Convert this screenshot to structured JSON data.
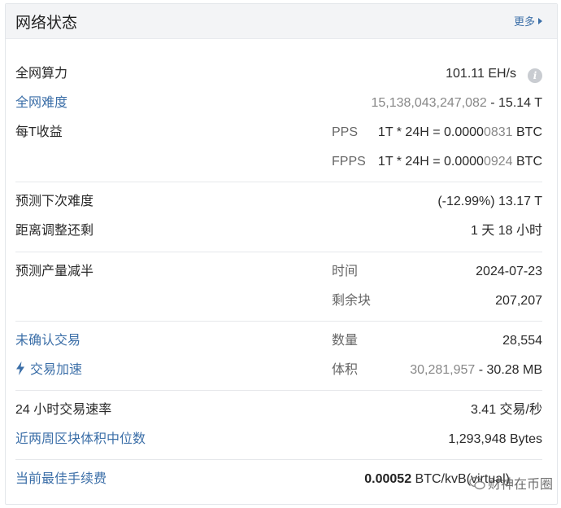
{
  "header": {
    "title": "网络状态",
    "more": "更多"
  },
  "hashrate": {
    "label": "全网算力",
    "value": "101.11 EH/s"
  },
  "difficulty": {
    "label": "全网难度",
    "raw": "15,138,043,247,082",
    "sep": " - ",
    "short": "15.14 T"
  },
  "income": {
    "label": "每T收益",
    "pps_label": "PPS",
    "pps_formula": "1T * 24H = 0.0000",
    "pps_tail": "0831",
    "pps_unit": " BTC",
    "fpps_label": "FPPS",
    "fpps_formula": "1T * 24H = 0.0000",
    "fpps_tail": "0924",
    "fpps_unit": " BTC"
  },
  "next_difficulty": {
    "label": "预测下次难度",
    "value": "(-12.99%) 13.17 T"
  },
  "adjust": {
    "label": "距离调整还剩",
    "value": "1 天 18 小时"
  },
  "halving": {
    "label": "预测产量减半",
    "time_label": "时间",
    "time_value": "2024-07-23",
    "blocks_label": "剩余块",
    "blocks_value": "207,207"
  },
  "unconfirmed": {
    "label": "未确认交易",
    "count_label": "数量",
    "count_value": "28,554"
  },
  "accelerate": {
    "label": "交易加速",
    "size_label": "体积",
    "size_raw": "30,281,957",
    "size_sep": " - ",
    "size_short": "30.28 MB"
  },
  "tx_rate": {
    "label": "24 小时交易速率",
    "value": "3.41 交易/秒"
  },
  "median_block": {
    "label": "近两周区块体积中位数",
    "value": "1,293,948 Bytes"
  },
  "best_fee": {
    "label": "当前最佳手续费",
    "value_bold": "0.00052",
    "value_unit": " BTC/kvB(virtual)"
  },
  "watermark": {
    "text": "财神在币圈"
  },
  "icons": {
    "info": "info-icon",
    "bolt": "lightning-bolt-icon",
    "arrow": "chevron-right-icon",
    "wechat": "wechat-icon"
  },
  "colors": {
    "link": "#3c6fa8",
    "header_bg": "#f3f4f6"
  }
}
